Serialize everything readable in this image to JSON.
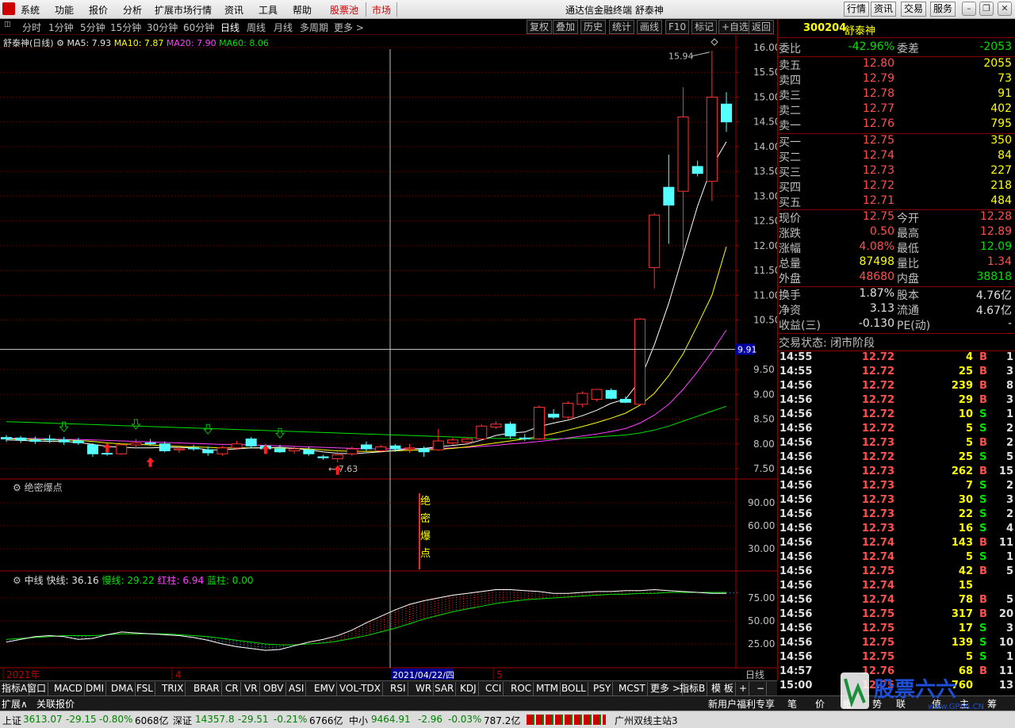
{
  "menu": {
    "items": [
      "系统",
      "功能",
      "报价",
      "分析",
      "扩展市场行情",
      "资讯",
      "工具",
      "帮助"
    ],
    "hot1": "股票池",
    "hot2": "市场",
    "title": "通达信金融终端 舒泰神",
    "right_buttons": [
      "行情",
      "资讯",
      "交易",
      "服务"
    ]
  },
  "toolbar": {
    "periods": [
      "分时",
      "1分钟",
      "5分钟",
      "15分钟",
      "30分钟",
      "60分钟",
      "日线",
      "周线",
      "月线",
      "多周期",
      "更多 >"
    ],
    "active_period": "日线",
    "buttons": [
      "复权",
      "叠加",
      "历史",
      "统计",
      "画线",
      "F10",
      "标记",
      "+自选",
      "返回"
    ]
  },
  "main_chart": {
    "stock_label": "舒泰神(日线)",
    "ma5": "MA5: 7.93",
    "ma10": "MA10: 7.87",
    "ma20": "MA20: 7.90",
    "ma60": "MA60: 8.06",
    "high_label": "15.94",
    "low_label": "7.63",
    "cursor_price": "9.91",
    "cursor_date": "2021/04/22/四",
    "x_labels": [
      "2021年",
      "4",
      "5"
    ],
    "period_label": "日线",
    "colors": {
      "up": "#ff3232",
      "down": "#54ffff",
      "ma5": "#ffffff",
      "ma10": "#ffff00",
      "ma20": "#ff40ff",
      "ma60": "#00e000"
    }
  },
  "chart_data": {
    "type": "candlestick",
    "y_ticks": [
      7.5,
      8.0,
      8.5,
      9.0,
      9.5,
      10.5,
      11.0,
      11.5,
      12.0,
      12.5,
      13.0,
      13.5,
      14.0,
      14.5,
      15.0,
      15.5,
      16.0
    ],
    "ylim": [
      7.3,
      16.2
    ],
    "candles": [
      {
        "o": 8.13,
        "h": 8.18,
        "l": 8.04,
        "c": 8.1
      },
      {
        "o": 8.12,
        "h": 8.16,
        "l": 8.02,
        "c": 8.08
      },
      {
        "o": 8.08,
        "h": 8.15,
        "l": 8.0,
        "c": 8.05
      },
      {
        "o": 8.1,
        "h": 8.18,
        "l": 8.02,
        "c": 8.08
      },
      {
        "o": 8.08,
        "h": 8.14,
        "l": 7.98,
        "c": 8.04
      },
      {
        "o": 8.06,
        "h": 8.12,
        "l": 7.98,
        "c": 8.02
      },
      {
        "o": 7.98,
        "h": 8.02,
        "l": 7.74,
        "c": 7.8
      },
      {
        "o": 7.81,
        "h": 7.85,
        "l": 7.76,
        "c": 7.8
      },
      {
        "o": 7.8,
        "h": 8.02,
        "l": 7.78,
        "c": 7.98
      },
      {
        "o": 7.98,
        "h": 8.1,
        "l": 7.9,
        "c": 8.02
      },
      {
        "o": 8.02,
        "h": 8.1,
        "l": 7.96,
        "c": 8.0
      },
      {
        "o": 8.0,
        "h": 8.05,
        "l": 7.83,
        "c": 7.86
      },
      {
        "o": 7.88,
        "h": 7.94,
        "l": 7.82,
        "c": 7.9
      },
      {
        "o": 7.92,
        "h": 7.98,
        "l": 7.86,
        "c": 7.9
      },
      {
        "o": 7.88,
        "h": 7.95,
        "l": 7.76,
        "c": 7.82
      },
      {
        "o": 7.8,
        "h": 7.96,
        "l": 7.76,
        "c": 7.92
      },
      {
        "o": 7.92,
        "h": 8.06,
        "l": 7.88,
        "c": 8.0
      },
      {
        "o": 8.1,
        "h": 8.14,
        "l": 7.92,
        "c": 7.96
      },
      {
        "o": 7.96,
        "h": 8.0,
        "l": 7.88,
        "c": 7.9
      },
      {
        "o": 7.9,
        "h": 7.98,
        "l": 7.82,
        "c": 7.84
      },
      {
        "o": 7.86,
        "h": 7.95,
        "l": 7.8,
        "c": 7.9
      },
      {
        "o": 7.88,
        "h": 7.94,
        "l": 7.76,
        "c": 7.8
      },
      {
        "o": 7.74,
        "h": 7.78,
        "l": 7.68,
        "c": 7.72
      },
      {
        "o": 7.7,
        "h": 7.84,
        "l": 7.63,
        "c": 7.78
      },
      {
        "o": 7.8,
        "h": 7.95,
        "l": 7.76,
        "c": 7.9
      },
      {
        "o": 7.98,
        "h": 8.05,
        "l": 7.86,
        "c": 7.9
      },
      {
        "o": 7.86,
        "h": 7.98,
        "l": 7.82,
        "c": 7.94
      },
      {
        "o": 7.96,
        "h": 8.0,
        "l": 7.84,
        "c": 7.9
      },
      {
        "o": 7.9,
        "h": 8.0,
        "l": 7.82,
        "c": 7.92
      },
      {
        "o": 7.9,
        "h": 7.95,
        "l": 7.74,
        "c": 7.84
      },
      {
        "o": 7.88,
        "h": 8.3,
        "l": 7.86,
        "c": 8.06
      },
      {
        "o": 8.02,
        "h": 8.12,
        "l": 7.98,
        "c": 8.08
      },
      {
        "o": 8.04,
        "h": 8.14,
        "l": 7.98,
        "c": 8.1
      },
      {
        "o": 8.1,
        "h": 8.4,
        "l": 8.08,
        "c": 8.36
      },
      {
        "o": 8.34,
        "h": 8.46,
        "l": 8.3,
        "c": 8.4
      },
      {
        "o": 8.4,
        "h": 8.45,
        "l": 8.1,
        "c": 8.16
      },
      {
        "o": 8.12,
        "h": 8.2,
        "l": 8.06,
        "c": 8.1
      },
      {
        "o": 8.1,
        "h": 8.78,
        "l": 8.08,
        "c": 8.74
      },
      {
        "o": 8.6,
        "h": 8.7,
        "l": 8.5,
        "c": 8.54
      },
      {
        "o": 8.54,
        "h": 8.86,
        "l": 8.5,
        "c": 8.82
      },
      {
        "o": 8.8,
        "h": 9.06,
        "l": 8.74,
        "c": 9.02
      },
      {
        "o": 8.9,
        "h": 9.1,
        "l": 8.86,
        "c": 9.1
      },
      {
        "o": 9.08,
        "h": 9.12,
        "l": 8.9,
        "c": 8.92
      },
      {
        "o": 8.9,
        "h": 8.96,
        "l": 8.82,
        "c": 8.84
      },
      {
        "o": 8.8,
        "h": 10.54,
        "l": 8.78,
        "c": 10.52
      },
      {
        "o": 11.56,
        "h": 12.66,
        "l": 11.14,
        "c": 12.62
      },
      {
        "o": 13.18,
        "h": 13.84,
        "l": 12.04,
        "c": 12.82
      },
      {
        "o": 13.1,
        "h": 15.2,
        "l": 11.9,
        "c": 14.6
      },
      {
        "o": 13.6,
        "h": 13.72,
        "l": 13.4,
        "c": 13.46
      },
      {
        "o": 13.3,
        "h": 15.94,
        "l": 12.9,
        "c": 15.0
      },
      {
        "o": 14.86,
        "h": 15.1,
        "l": 14.3,
        "c": 14.5
      }
    ],
    "ma5": [
      8.08,
      8.07,
      8.06,
      8.05,
      8.05,
      8.03,
      7.99,
      7.95,
      7.93,
      7.92,
      7.92,
      7.93,
      7.93,
      7.92,
      7.88,
      7.88,
      7.9,
      7.92,
      7.92,
      7.93,
      7.91,
      7.88,
      7.84,
      7.81,
      7.8,
      7.82,
      7.84,
      7.87,
      7.9,
      7.91,
      7.94,
      7.97,
      8.0,
      8.08,
      8.17,
      8.22,
      8.24,
      8.35,
      8.42,
      8.48,
      8.57,
      8.68,
      8.82,
      8.9,
      9.28,
      10.0,
      10.84,
      11.82,
      12.8,
      13.6,
      14.1
    ],
    "ma10": [
      8.1,
      8.1,
      8.09,
      8.08,
      8.08,
      8.07,
      8.05,
      8.02,
      8.0,
      7.99,
      7.98,
      7.96,
      7.95,
      7.94,
      7.93,
      7.92,
      7.92,
      7.92,
      7.92,
      7.92,
      7.91,
      7.9,
      7.88,
      7.86,
      7.85,
      7.85,
      7.85,
      7.86,
      7.87,
      7.88,
      7.89,
      7.91,
      7.94,
      7.98,
      8.02,
      8.06,
      8.1,
      8.15,
      8.21,
      8.28,
      8.35,
      8.43,
      8.52,
      8.62,
      8.78,
      9.02,
      9.38,
      9.82,
      10.4,
      11.0,
      11.98
    ],
    "ma20": [
      8.12,
      8.11,
      8.11,
      8.1,
      8.09,
      8.09,
      8.08,
      8.07,
      8.06,
      8.05,
      8.04,
      8.03,
      8.02,
      8.01,
      8.0,
      7.99,
      7.99,
      7.98,
      7.97,
      7.96,
      7.95,
      7.94,
      7.93,
      7.92,
      7.91,
      7.9,
      7.9,
      7.9,
      7.9,
      7.9,
      7.91,
      7.92,
      7.93,
      7.95,
      7.97,
      8.0,
      8.02,
      8.05,
      8.08,
      8.12,
      8.16,
      8.2,
      8.25,
      8.31,
      8.42,
      8.58,
      8.8,
      9.1,
      9.46,
      9.86,
      10.3
    ],
    "ma60": [
      8.45,
      8.44,
      8.43,
      8.42,
      8.41,
      8.4,
      8.39,
      8.38,
      8.37,
      8.36,
      8.35,
      8.34,
      8.33,
      8.32,
      8.31,
      8.3,
      8.29,
      8.28,
      8.27,
      8.26,
      8.25,
      8.24,
      8.23,
      8.22,
      8.21,
      8.2,
      8.19,
      8.18,
      8.17,
      8.16,
      8.15,
      8.14,
      8.13,
      8.12,
      8.11,
      8.11,
      8.1,
      8.1,
      8.1,
      8.11,
      8.12,
      8.14,
      8.16,
      8.18,
      8.22,
      8.28,
      8.36,
      8.46,
      8.56,
      8.66,
      8.76
    ],
    "ind1": {
      "title": "绝密爆点",
      "y_ticks": [
        30.0,
        60.0,
        90.0
      ],
      "marker_text": "绝密爆点"
    },
    "ind2": {
      "title": "中线",
      "fast": "快线: 36.16",
      "slow": "慢线: 29.22",
      "red": "红柱: 6.94",
      "blue": "蓝柱: 0.00",
      "y_ticks": [
        25.0,
        50.0,
        75.0
      ],
      "fast_values": [
        27,
        30,
        33,
        34,
        33,
        30,
        31,
        35,
        38,
        37,
        36,
        35,
        34,
        32,
        29,
        25,
        22,
        20,
        18,
        19,
        23,
        27,
        30,
        34,
        40,
        48,
        55,
        62,
        68,
        72,
        75,
        78,
        80,
        82,
        84,
        84,
        83,
        82,
        80,
        80,
        81,
        82,
        82,
        83,
        83,
        84,
        83,
        82,
        81,
        80,
        80
      ],
      "slow_values": [
        30,
        31,
        32,
        33,
        34,
        34,
        34,
        35,
        36,
        36,
        36,
        36,
        35,
        34,
        33,
        31,
        29,
        27,
        25,
        24,
        24,
        25,
        26,
        28,
        31,
        34,
        38,
        42,
        47,
        52,
        56,
        60,
        63,
        66,
        69,
        71,
        73,
        74,
        75,
        76,
        77,
        78,
        79,
        79,
        80,
        80,
        81,
        81,
        81,
        81,
        81
      ]
    }
  },
  "right_panel": {
    "code": "300204",
    "name": "舒泰神",
    "weibi_label": "委比",
    "weibi": "-42.96%",
    "weicha_label": "委差",
    "weicha": "-2053",
    "sells": [
      {
        "label": "卖五",
        "price": "12.80",
        "vol": "2055"
      },
      {
        "label": "卖四",
        "price": "12.79",
        "vol": "73"
      },
      {
        "label": "卖三",
        "price": "12.78",
        "vol": "91"
      },
      {
        "label": "卖二",
        "price": "12.77",
        "vol": "402"
      },
      {
        "label": "卖一",
        "price": "12.76",
        "vol": "795"
      }
    ],
    "buys": [
      {
        "label": "买一",
        "price": "12.75",
        "vol": "350"
      },
      {
        "label": "买二",
        "price": "12.74",
        "vol": "84"
      },
      {
        "label": "买三",
        "price": "12.73",
        "vol": "227"
      },
      {
        "label": "买四",
        "price": "12.72",
        "vol": "218"
      },
      {
        "label": "买五",
        "price": "12.71",
        "vol": "484"
      }
    ],
    "stats": [
      {
        "l1": "现价",
        "v1": "12.75",
        "l2": "今开",
        "v2": "12.28"
      },
      {
        "l1": "涨跌",
        "v1": "0.50",
        "l2": "最高",
        "v2": "12.89"
      },
      {
        "l1": "涨幅",
        "v1": "4.08%",
        "l2": "最低",
        "v2": "12.09"
      },
      {
        "l1": "总量",
        "v1": "87498",
        "l2": "量比",
        "v2": "1.34"
      },
      {
        "l1": "外盘",
        "v1": "48680",
        "l2": "内盘",
        "v2": "38818"
      }
    ],
    "stats2": [
      {
        "l1": "换手",
        "v1": "1.87%",
        "l2": "股本",
        "v2": "4.76亿"
      },
      {
        "l1": "净资",
        "v1": "3.13",
        "l2": "流通",
        "v2": "4.67亿"
      },
      {
        "l1": "收益(三)",
        "v1": "-0.130",
        "l2": "PE(动)",
        "v2": "-"
      }
    ],
    "trade_status": "交易状态: 闭市阶段",
    "ticks": [
      {
        "t": "14:55",
        "p": "12.72",
        "v": "4",
        "bs": "B",
        "n": "1"
      },
      {
        "t": "14:55",
        "p": "12.72",
        "v": "25",
        "bs": "B",
        "n": "3"
      },
      {
        "t": "14:56",
        "p": "12.72",
        "v": "239",
        "bs": "B",
        "n": "8"
      },
      {
        "t": "14:56",
        "p": "12.72",
        "v": "29",
        "bs": "B",
        "n": "3"
      },
      {
        "t": "14:56",
        "p": "12.72",
        "v": "10",
        "bs": "S",
        "n": "1"
      },
      {
        "t": "14:56",
        "p": "12.72",
        "v": "5",
        "bs": "S",
        "n": "2"
      },
      {
        "t": "14:56",
        "p": "12.73",
        "v": "5",
        "bs": "B",
        "n": "2"
      },
      {
        "t": "14:56",
        "p": "12.72",
        "v": "25",
        "bs": "S",
        "n": "5"
      },
      {
        "t": "14:56",
        "p": "12.73",
        "v": "262",
        "bs": "B",
        "n": "15"
      },
      {
        "t": "14:56",
        "p": "12.73",
        "v": "7",
        "bs": "S",
        "n": "2"
      },
      {
        "t": "14:56",
        "p": "12.73",
        "v": "30",
        "bs": "S",
        "n": "3"
      },
      {
        "t": "14:56",
        "p": "12.73",
        "v": "22",
        "bs": "S",
        "n": "2"
      },
      {
        "t": "14:56",
        "p": "12.73",
        "v": "16",
        "bs": "S",
        "n": "4"
      },
      {
        "t": "14:56",
        "p": "12.74",
        "v": "143",
        "bs": "B",
        "n": "11"
      },
      {
        "t": "14:56",
        "p": "12.74",
        "v": "5",
        "bs": "S",
        "n": "1"
      },
      {
        "t": "14:56",
        "p": "12.75",
        "v": "42",
        "bs": "B",
        "n": "5"
      },
      {
        "t": "14:56",
        "p": "12.74",
        "v": "15",
        "bs": "",
        "n": ""
      },
      {
        "t": "14:56",
        "p": "12.74",
        "v": "78",
        "bs": "B",
        "n": "5"
      },
      {
        "t": "14:56",
        "p": "12.75",
        "v": "317",
        "bs": "B",
        "n": "20"
      },
      {
        "t": "14:56",
        "p": "12.75",
        "v": "17",
        "bs": "S",
        "n": "3"
      },
      {
        "t": "14:56",
        "p": "12.75",
        "v": "139",
        "bs": "S",
        "n": "10"
      },
      {
        "t": "14:56",
        "p": "12.75",
        "v": "5",
        "bs": "S",
        "n": "1"
      },
      {
        "t": "14:57",
        "p": "12.76",
        "v": "68",
        "bs": "B",
        "n": "11"
      },
      {
        "t": "15:00",
        "p": "12.75",
        "v": "760",
        "bs": "",
        "n": "13"
      }
    ]
  },
  "indicator_tabs": [
    "指标A",
    "窗口",
    "MACD",
    "DMI",
    "DMA",
    "FSL",
    "TRIX",
    "BRAR",
    "CR",
    "VR",
    "OBV",
    "ASI",
    "EMV",
    "VOL-TDX",
    "RSI",
    "WR",
    "SAR",
    "KDJ",
    "CCI",
    "ROC",
    "MTM",
    "BOLL",
    "PSY",
    "MCST",
    "更多 >"
  ],
  "indicator_tabs_right": [
    "指标B",
    "模 板",
    "+",
    "−"
  ],
  "bottom_left": [
    "扩展∧",
    "关联报价"
  ],
  "bottom_right": [
    "新用户福利专享",
    "笔",
    "价",
    "细",
    "势",
    "联",
    "值",
    "主",
    "筹"
  ],
  "status": {
    "sh_label": "上证",
    "sh_val": "3613.07",
    "sh_chg": "-29.15",
    "sh_pct": "-0.80%",
    "sh_amt": "6068亿",
    "sz_label": "深证",
    "sz_val": "14357.8",
    "sz_chg": "-29.51",
    "sz_pct": "-0.21%",
    "sz_amt": "6766亿",
    "zx_label": "中小",
    "zx_val": "9464.91",
    "zx_chg": "-2.96",
    "zx_pct": "-0.03%",
    "zx_amt": "787.2亿",
    "server": "广州双线主站3"
  },
  "watermark": {
    "brand": "股票六六",
    "url": "www.GP66.CN"
  }
}
